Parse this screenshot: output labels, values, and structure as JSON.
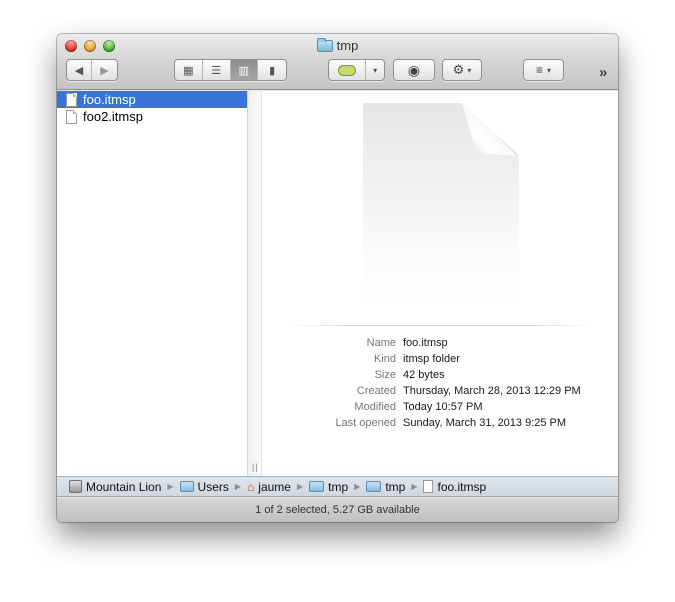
{
  "window": {
    "title": "tmp",
    "title_icon": "folder-icon"
  },
  "toolbar": {
    "back_icon": "◀",
    "forward_icon": "▶",
    "view_modes": [
      {
        "name": "icon-view",
        "glyph": "▦",
        "active": false
      },
      {
        "name": "list-view",
        "glyph": "☰",
        "active": false
      },
      {
        "name": "column-view",
        "glyph": "▥",
        "active": true
      },
      {
        "name": "coverflow-view",
        "glyph": "▮",
        "active": false
      }
    ],
    "label_color": "#c0dc6a",
    "caret": "▾",
    "quicklook_icon": "◉",
    "action_icon": "⚙",
    "arrange_icon": "≡",
    "more_icon": "»"
  },
  "sidebar": {
    "files": [
      {
        "name": "foo.itmsp",
        "selected": true
      },
      {
        "name": "foo2.itmsp",
        "selected": false
      }
    ]
  },
  "divider": {
    "grip": "||"
  },
  "preview": {
    "info": [
      {
        "key": "Name",
        "value": "foo.itmsp"
      },
      {
        "key": "Kind",
        "value": "itmsp folder"
      },
      {
        "key": "Size",
        "value": "42 bytes"
      },
      {
        "key": "Created",
        "value": "Thursday, March 28, 2013 12:29 PM"
      },
      {
        "key": "Modified",
        "value": "Today 10:57 PM"
      },
      {
        "key": "Last opened",
        "value": "Sunday, March 31, 2013 9:25 PM"
      }
    ]
  },
  "pathbar": {
    "separator": "▶",
    "crumbs": [
      {
        "label": "Mountain Lion",
        "icon": "disk-icon"
      },
      {
        "label": "Users",
        "icon": "users-folder-icon"
      },
      {
        "label": "jaume",
        "icon": "home-icon"
      },
      {
        "label": "tmp",
        "icon": "folder-icon"
      },
      {
        "label": "tmp",
        "icon": "folder-icon"
      },
      {
        "label": "foo.itmsp",
        "icon": "document-icon"
      }
    ]
  },
  "status": {
    "text": "1 of 2 selected, 5.27 GB available"
  },
  "colors": {
    "selection": "#3875d7",
    "pathbar": "#d7dee6"
  }
}
